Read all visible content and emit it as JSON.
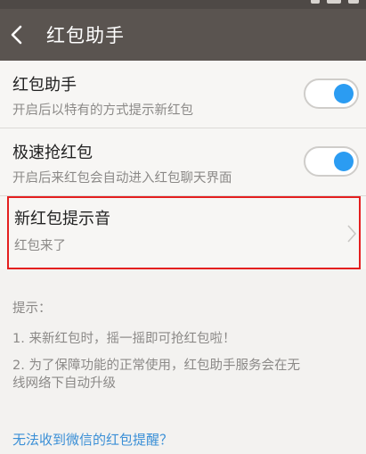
{
  "header": {
    "title": "红包助手"
  },
  "settings": [
    {
      "title": "红包助手",
      "subtitle": "开启后以特有的方式提示新红包",
      "toggle": true
    },
    {
      "title": "极速抢红包",
      "subtitle": "开启后来红包会自动进入红包聊天界面",
      "toggle": true
    },
    {
      "title": "新红包提示音",
      "subtitle": "红包来了",
      "highlighted": true
    }
  ],
  "tips": {
    "heading": "提示：",
    "line1": "1. 来新红包时，摇一摇即可抢红包啦！",
    "line2a": "2. 为了保障功能的正常使用，红包助手服务会在无",
    "line2b": "线网络下自动升级"
  },
  "help_link": "无法收到微信的红包提醒？",
  "colors": {
    "header": "#5a5450",
    "toggle_on": "#2b9cf2",
    "highlight_border": "#e41f1f",
    "link": "#3a8fd6"
  }
}
